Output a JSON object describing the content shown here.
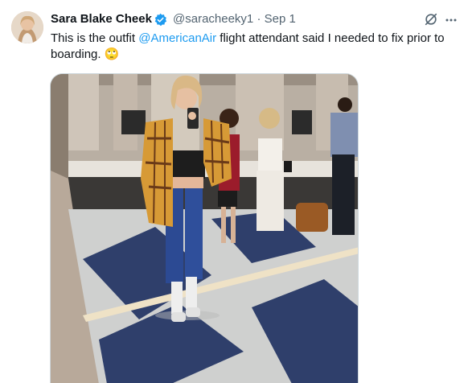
{
  "tweet": {
    "author_name": "Sara Blake Cheek",
    "handle": "@saracheeky1",
    "separator": "·",
    "date": "Sep 1",
    "text_before": "This is the outfit ",
    "mention": "@AmericanAir",
    "text_after": " flight attendant said I needed to fix prior to boarding.",
    "emoji": "🙄"
  },
  "icons": {
    "verified": "verified-badge-icon",
    "grok": "grok-icon",
    "more": "more-options-icon"
  },
  "colors": {
    "verified": "#1d9bf0",
    "mention": "#1d9bf0",
    "secondary_text": "#536471"
  }
}
